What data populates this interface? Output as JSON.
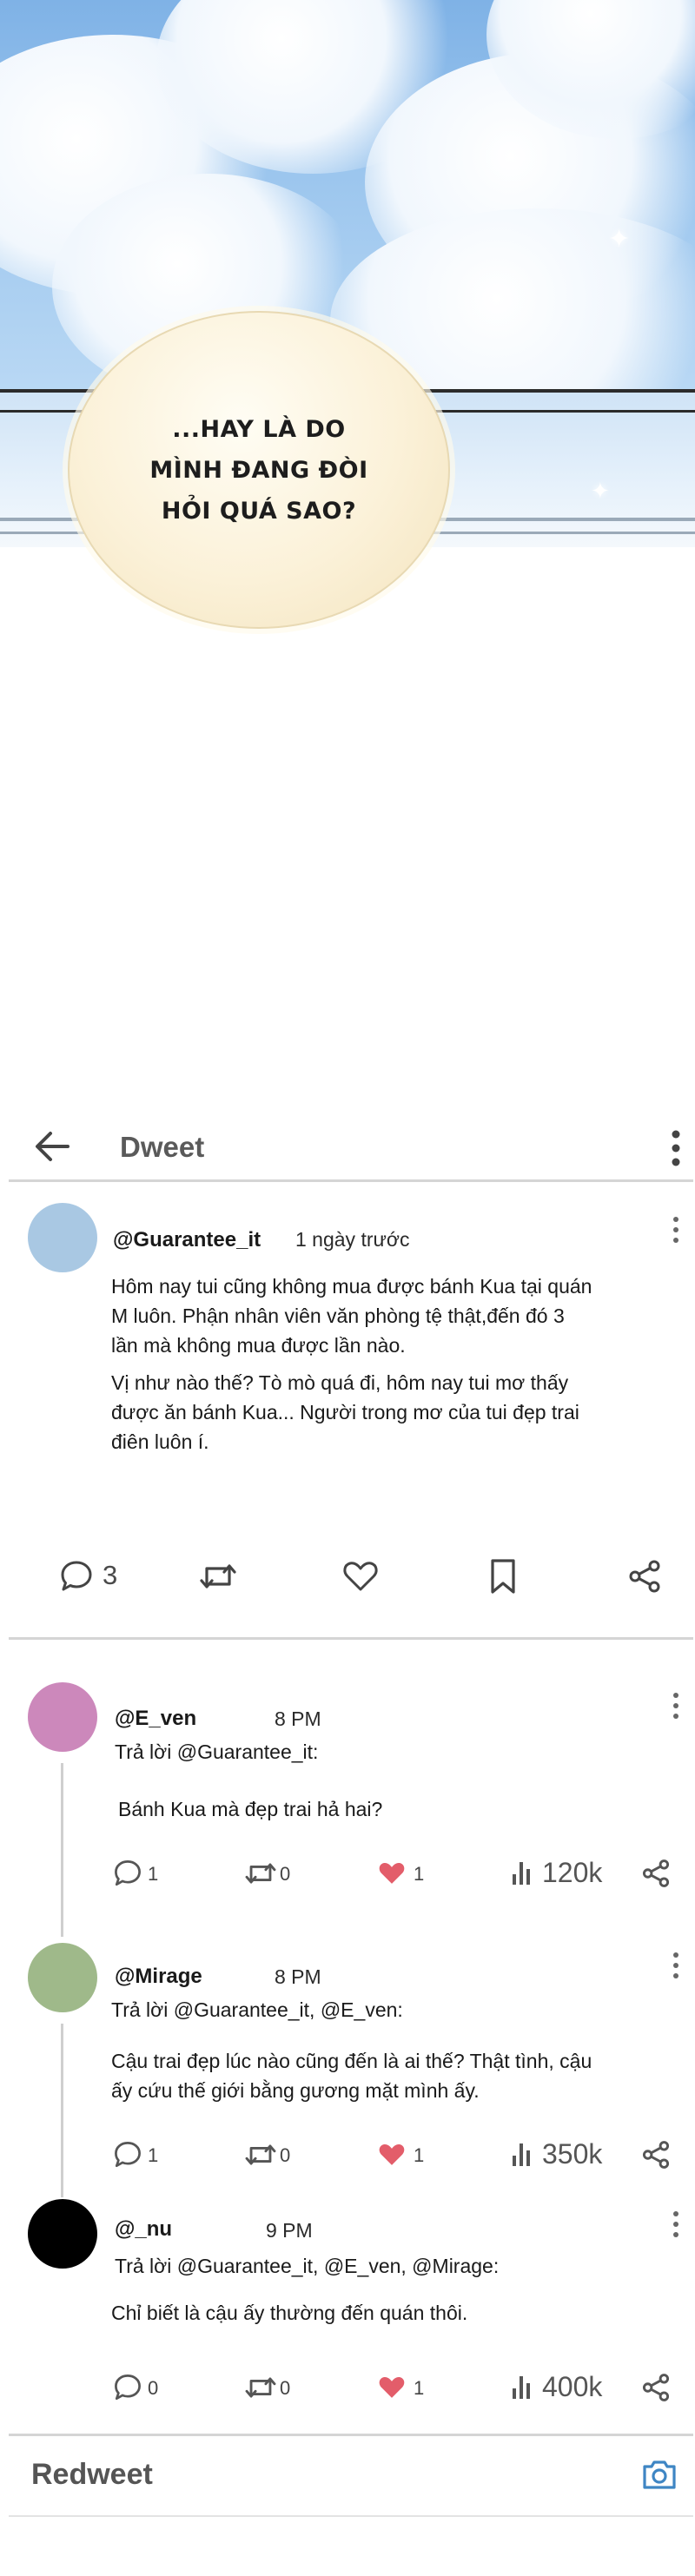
{
  "comic": {
    "bubble_lines": [
      "...HAY LÀ DO",
      "MÌNH ĐANG ĐÒI",
      "HỎI QUÁ SAO?"
    ]
  },
  "app": {
    "title": "Dweet",
    "footer_title": "Redweet"
  },
  "post": {
    "handle": "@Guarantee_it",
    "time": "1 ngày trước",
    "avatar_color": "#a9c8e3",
    "paragraph1": [
      "Hôm nay tui cũng không mua được bánh Kua tại quán",
      "M luôn. Phận nhân viên văn phòng tệ thật,đến đó 3",
      "lần mà không mua được lần nào."
    ],
    "paragraph2": [
      "Vị như nào thế? Tò mò quá đi, hôm nay tui mơ thấy",
      "được ăn bánh Kua... Người trong mơ của tui đẹp trai",
      "điên luôn í."
    ],
    "comment_count": "3"
  },
  "replies": [
    {
      "handle": "@E_ven",
      "time": "8 PM",
      "reply_to": "Trả lời @Guarantee_it:",
      "lines": [
        "Bánh Kua mà đẹp trai hả hai?"
      ],
      "comments": "1",
      "redweets": "0",
      "likes": "1",
      "views": "120k",
      "avatar_color": "#cc88bb"
    },
    {
      "handle": "@Mirage",
      "time": "8 PM",
      "reply_to": "Trả lời @Guarantee_it, @E_ven:",
      "lines": [
        "Cậu trai đẹp lúc nào cũng đến là ai thế? Thật tình, cậu",
        "ấy cứu thế giới bằng gương mặt mình ấy."
      ],
      "comments": "1",
      "redweets": "0",
      "likes": "1",
      "views": "350k",
      "avatar_color": "#9fb98a"
    },
    {
      "handle": "@_nu",
      "time": "9 PM",
      "reply_to": "Trả lời @Guarantee_it, @E_ven, @Mirage:",
      "lines": [
        "Chỉ biết là cậu ấy thường đến quán thôi."
      ],
      "comments": "0",
      "redweets": "0",
      "likes": "1",
      "views": "400k",
      "avatar_color": "#000000"
    }
  ],
  "icons": {
    "back": "arrow-left-icon",
    "more": "more-vertical-icon",
    "comment": "comment-icon",
    "redweet": "repeat-icon",
    "like": "heart-icon",
    "bookmark": "bookmark-icon",
    "share": "share-icon",
    "views": "bar-chart-icon",
    "camera": "camera-icon"
  },
  "colors": {
    "like_filled": "#e35d6a",
    "divider": "#d5d5d5"
  }
}
